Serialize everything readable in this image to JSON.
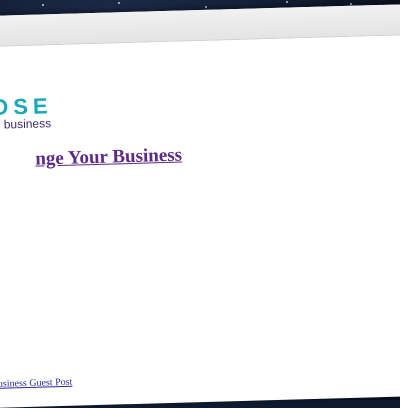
{
  "logo": {
    "word": "OSE",
    "sub": "business"
  },
  "main": {
    "headline_link": "nge Your Business"
  },
  "footer": {
    "link": "usiness Guest Post"
  },
  "colors": {
    "logo_teal": "#1aa9b6",
    "logo_purple": "#3a2a6a",
    "headline_visited": "#5c2a86",
    "link_blue": "#2a2a9a"
  }
}
